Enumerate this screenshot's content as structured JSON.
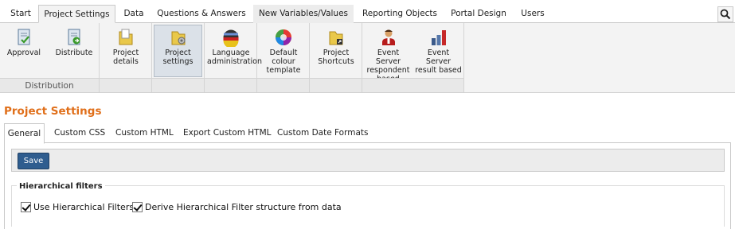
{
  "menu": {
    "tabs": [
      {
        "label": "Start"
      },
      {
        "label": "Project Settings"
      },
      {
        "label": "Data"
      },
      {
        "label": "Questions & Answers"
      },
      {
        "label": "New Variables/Values"
      },
      {
        "label": "Reporting Objects"
      },
      {
        "label": "Portal Design"
      },
      {
        "label": "Users"
      }
    ],
    "active": "Project Settings",
    "search_icon": "search-icon"
  },
  "ribbon": {
    "distribution": {
      "group_label": "Distribution",
      "buttons": [
        {
          "label": "Approval",
          "icon": "approval-icon"
        },
        {
          "label": "Distribute",
          "icon": "distribute-icon"
        }
      ]
    },
    "buttons": [
      {
        "label": "Project details",
        "icon": "folder-icon"
      },
      {
        "label": "Project settings",
        "icon": "folder-settings-icon",
        "selected": true
      },
      {
        "label": "Language administration",
        "icon": "globe-flag-icon"
      },
      {
        "label": "Default colour template",
        "icon": "color-wheel-icon"
      },
      {
        "label": "Project Shortcuts",
        "icon": "folder-shortcut-icon"
      },
      {
        "label": "Event Server respondent based",
        "icon": "person-icon"
      },
      {
        "label": "Event Server result based",
        "icon": "bar-chart-icon"
      }
    ]
  },
  "page": {
    "title": "Project Settings",
    "subtabs": [
      {
        "label": "General"
      },
      {
        "label": "Custom CSS"
      },
      {
        "label": "Custom HTML"
      },
      {
        "label": "Export Custom HTML"
      },
      {
        "label": "Custom Date Formats"
      }
    ],
    "active_subtab": "General",
    "save_label": "Save",
    "hierarchical": {
      "legend": "Hierarchical filters",
      "use_label": "Use Hierarchical Filters",
      "use_checked": true,
      "derive_label": "Derive Hierarchical Filter structure from data",
      "derive_checked": true
    }
  },
  "colors": {
    "accent": "#e06f1a",
    "save_button": "#2f5d8f",
    "ribbon_bg": "#f3f3f3"
  }
}
